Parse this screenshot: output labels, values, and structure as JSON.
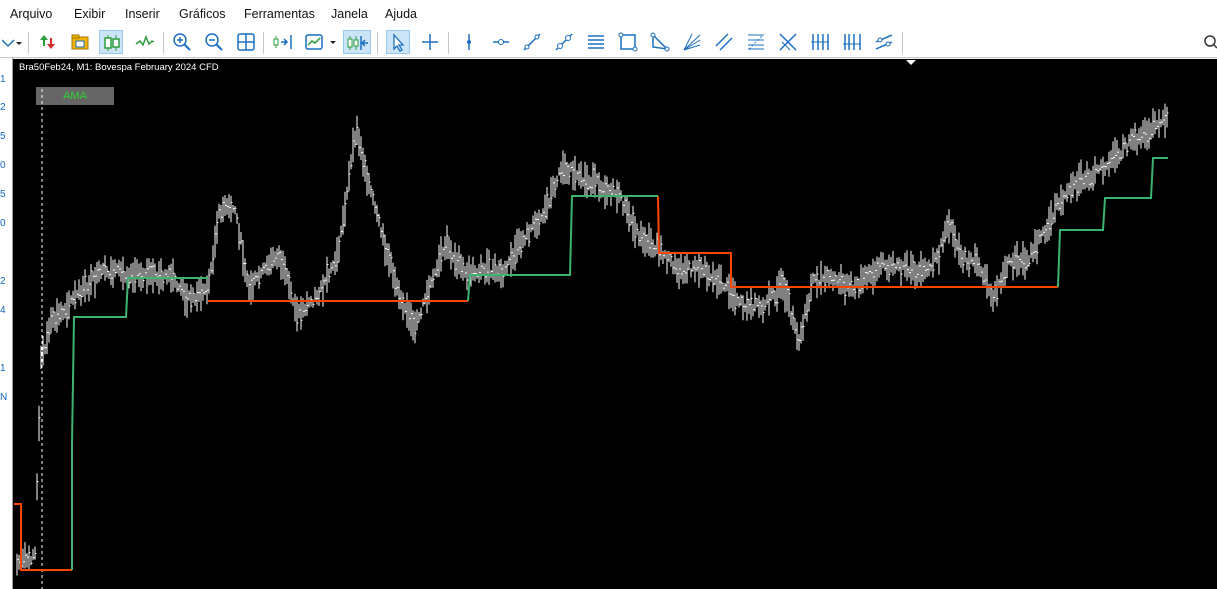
{
  "menu": {
    "items": [
      "Arquivo",
      "Exibir",
      "Inserir",
      "Gráficos",
      "Ferramentas",
      "Janela",
      "Ajuda"
    ]
  },
  "toolbar": {
    "buttons": [
      "dropdown-arrow-icon",
      "one-click-trading-icon",
      "open-folder-icon",
      "candlesticks-icon",
      "line-chart-icon",
      "zoom-in-icon",
      "zoom-out-icon",
      "tile-windows-icon",
      "scroll-end-icon",
      "indicators-icon",
      "auto-scroll-icon",
      "cursor-icon",
      "crosshair-icon",
      "vertical-line-icon",
      "horizontal-line-icon",
      "trendline-icon",
      "trendline-angle-icon",
      "equidistant-channel-icon",
      "rectangle-icon",
      "triangle-icon",
      "fibonacci-fan-icon",
      "parallel-lines-icon",
      "fibonacci-retracement-icon",
      "gann-fan-icon",
      "cycle-lines-icon",
      "fibonacci-timezones-icon",
      "regression-channel-icon",
      "search-icon"
    ],
    "active": [
      "candlesticks-icon",
      "auto-scroll-icon",
      "cursor-icon"
    ]
  },
  "left_strip": {
    "labels": [
      "1",
      "2",
      "5",
      "0",
      "5",
      "0",
      "2",
      "4",
      "1",
      "N"
    ]
  },
  "chart": {
    "header": "Bra50Feb24, M1:  Bovespa February 2024 CFD",
    "indicator_label": "AMA",
    "colors": {
      "background": "#000000",
      "bars": "#ffffff",
      "ama_up": "#3cb371",
      "ama_down": "#ff4500",
      "indicator_text": "#2fd32f"
    }
  }
}
